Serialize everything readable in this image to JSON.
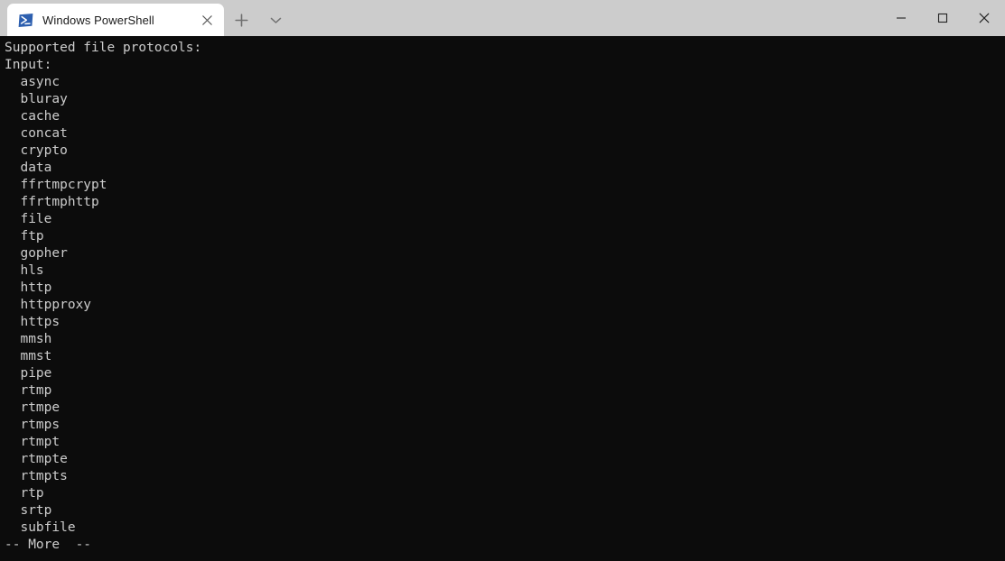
{
  "window": {
    "app_name": "Windows PowerShell",
    "colors": {
      "titlebar_bg": "#cccccc",
      "tab_bg": "#ffffff",
      "terminal_bg": "#0c0c0c",
      "terminal_fg": "#cccccc",
      "powershell_icon_blue": "#2d5faf"
    },
    "controls": {
      "minimize_label": "Minimize",
      "maximize_label": "Maximize",
      "close_label": "Close"
    },
    "tabbar": {
      "new_tab_label": "New tab",
      "dropdown_label": "Open new tab dropdown"
    }
  },
  "tabs": [
    {
      "title": "Windows PowerShell",
      "icon": "powershell-icon",
      "close_label": "Close tab",
      "active": true
    }
  ],
  "terminal": {
    "lines": [
      "Supported file protocols:",
      "Input:",
      "  async",
      "  bluray",
      "  cache",
      "  concat",
      "  crypto",
      "  data",
      "  ffrtmpcrypt",
      "  ffrtmphttp",
      "  file",
      "  ftp",
      "  gopher",
      "  hls",
      "  http",
      "  httpproxy",
      "  https",
      "  mmsh",
      "  mmst",
      "  pipe",
      "  rtmp",
      "  rtmpe",
      "  rtmps",
      "  rtmpt",
      "  rtmpte",
      "  rtmpts",
      "  rtp",
      "  srtp",
      "  subfile",
      "-- More  --"
    ]
  }
}
